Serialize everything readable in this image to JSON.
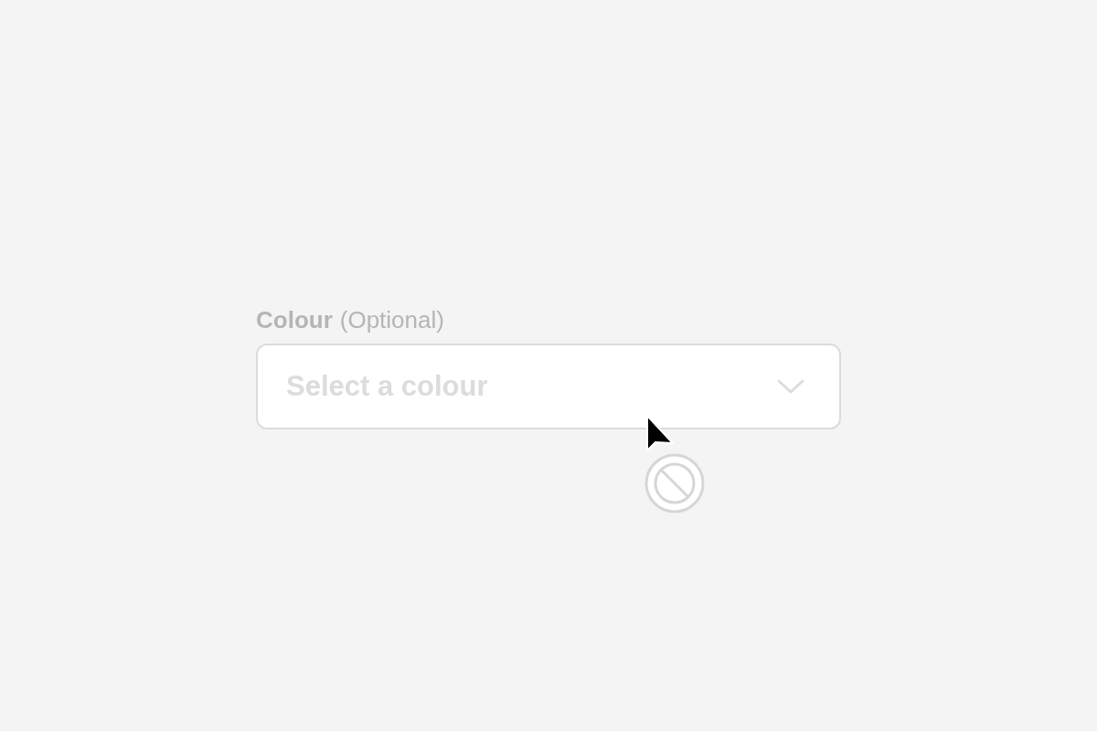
{
  "field": {
    "label": "Colour",
    "label_note": "(Optional)",
    "placeholder": "Select a colour",
    "disabled": true
  }
}
